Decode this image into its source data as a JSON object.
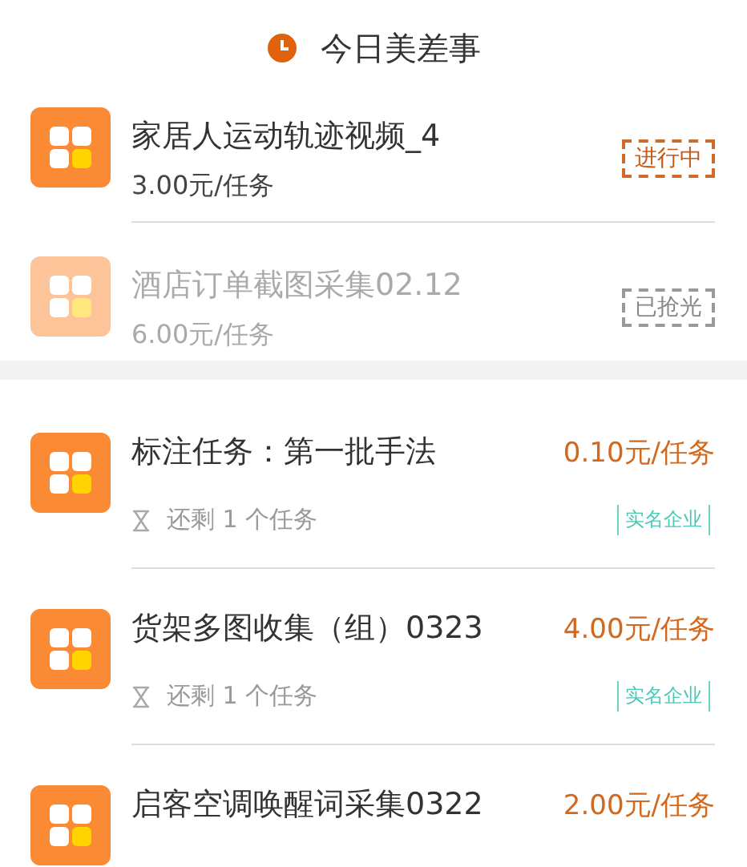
{
  "header": {
    "title": "今日美差事"
  },
  "today_tasks": [
    {
      "title": "家居人运动轨迹视频_4",
      "price": "3.00元/任务",
      "status": {
        "label": "进行中",
        "kind": "active"
      },
      "disabled": false
    },
    {
      "title": "酒店订单截图采集02.12",
      "price": "6.00元/任务",
      "status": {
        "label": "已抢光",
        "kind": "sold_out"
      },
      "disabled": true
    }
  ],
  "tasks": [
    {
      "title": "标注任务：第一批手法",
      "price": "0.10元/任务",
      "remaining": "还剩 1 个任务",
      "tag": "实名企业"
    },
    {
      "title": "货架多图收集（组）0323",
      "price": "4.00元/任务",
      "remaining": "还剩 1 个任务",
      "tag": "实名企业"
    },
    {
      "title": "启客空调唤醒词采集0322",
      "price": "2.00元/任务"
    }
  ]
}
